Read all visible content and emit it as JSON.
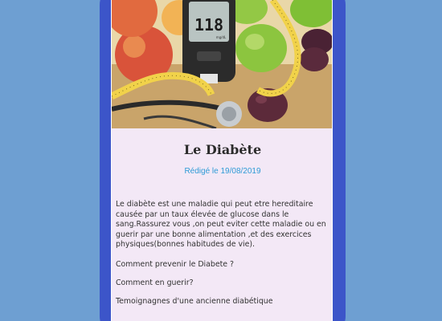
{
  "article": {
    "title": "Le Diabète",
    "date": "Rédigé le 19/08/2019",
    "body": "Le diabète est une maladie qui peut etre hereditaire causée par un taux élevée de glucose dans le sang.Rassurez vous ,on peut eviter cette maladie ou en guerir par une bonne alimentation ,et des exercices physiques(bonnes habitudes de vie).",
    "links": [
      "Comment prevenir le Diabete ?",
      "Comment en guerir?",
      "Temoignagnes d'une ancienne diabétique"
    ]
  },
  "hero": {
    "meter_reading": "118",
    "meter_unit": "mg/dL"
  },
  "colors": {
    "background": "#6e9fd2",
    "phone_frame": "#3c55c9",
    "content_bg": "#f3e8f6",
    "date_text": "#2e9bd6"
  }
}
